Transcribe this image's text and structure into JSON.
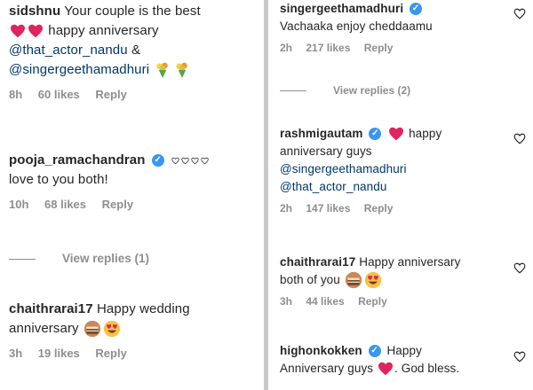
{
  "left": {
    "comments": [
      {
        "username": "sidshnu",
        "text1": "Your couple is the best",
        "text2": "happy anniversary",
        "mention1": "@that_actor_nandu",
        "amp": "&",
        "mention2": "@singergeethamadhuri",
        "time": "8h",
        "likes": "60 likes",
        "reply": "Reply"
      },
      {
        "username": "pooja_ramachandran",
        "text1": "love to you both!",
        "time": "10h",
        "likes": "68 likes",
        "reply": "Reply",
        "view_replies": "View replies (1)"
      },
      {
        "username": "chaithrarai17",
        "text1": "Happy wedding",
        "text2": "anniversary",
        "time": "3h",
        "likes": "19 likes",
        "reply": "Reply"
      }
    ]
  },
  "right": {
    "comments": [
      {
        "username": "singergeethamadhuri",
        "text1": "Vachaaka enjoy cheddaamu",
        "time": "2h",
        "likes": "217 likes",
        "reply": "Reply",
        "view_replies": "View replies (2)"
      },
      {
        "username": "rashmigautam",
        "text1": "happy",
        "text2": "anniversary guys",
        "mention1": "@singergeethamadhuri",
        "mention2": "@that_actor_nandu",
        "time": "2h",
        "likes": "147 likes",
        "reply": "Reply"
      },
      {
        "username": "chaithrarai17",
        "text1": "Happy anniversary",
        "text2": "both of you",
        "time": "3h",
        "likes": "44 likes",
        "reply": "Reply"
      },
      {
        "username": "highonkokken",
        "text1": "Happy",
        "text2": "Anniversary guys",
        "text3": ". God bless."
      }
    ]
  },
  "colors": {
    "heart": "#e0245e",
    "verified": "#3897f0",
    "mention": "#00376b",
    "meta": "#8e8e8e",
    "divider": "#c8c8c8"
  },
  "icons": [
    "verified-badge",
    "heart-emoji",
    "bouquet-emoji",
    "cake-emoji",
    "heart-eyes-emoji",
    "like-heart-icon"
  ]
}
